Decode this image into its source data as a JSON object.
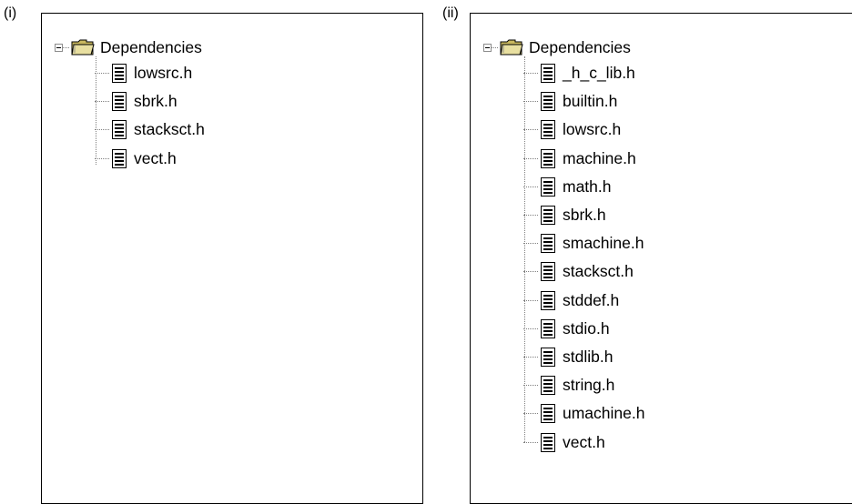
{
  "panels": [
    {
      "label": "(i)",
      "root": {
        "label": "Dependencies",
        "icon": "folder-icon",
        "expanded": true
      },
      "files": [
        "lowsrc.h",
        "sbrk.h",
        "stacksct.h",
        "vect.h"
      ]
    },
    {
      "label": "(ii)",
      "root": {
        "label": "Dependencies",
        "icon": "folder-icon",
        "expanded": true
      },
      "files": [
        "_h_c_lib.h",
        "builtin.h",
        "lowsrc.h",
        "machine.h",
        "math.h",
        "sbrk.h",
        "smachine.h",
        "stacksct.h",
        "stddef.h",
        "stdio.h",
        "stdlib.h",
        "string.h",
        "umachine.h",
        "vect.h"
      ]
    }
  ],
  "icons": {
    "expander": "minus-box-icon",
    "file": "document-icon",
    "folder": "folder-icon"
  },
  "colors": {
    "folder_body": "#c9b85f",
    "folder_tab": "#e8dfa0",
    "tree_lines": "#808080"
  }
}
